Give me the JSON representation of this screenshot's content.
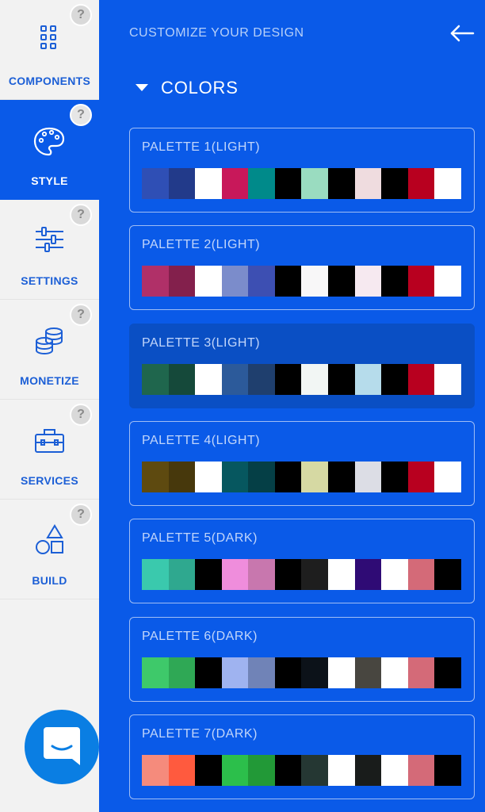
{
  "sidebar": {
    "items": [
      {
        "label": "COMPONENTS",
        "icon": "grid-icon",
        "active": false
      },
      {
        "label": "STYLE",
        "icon": "palette-icon",
        "active": true
      },
      {
        "label": "SETTINGS",
        "icon": "sliders-icon",
        "active": false
      },
      {
        "label": "MONETIZE",
        "icon": "coins-icon",
        "active": false
      },
      {
        "label": "SERVICES",
        "icon": "toolbox-icon",
        "active": false
      },
      {
        "label": "BUILD",
        "icon": "shapes-icon",
        "active": false
      }
    ],
    "help_label": "?"
  },
  "header": {
    "title": "CUSTOMIZE YOUR DESIGN",
    "back_icon": "arrow-left-icon"
  },
  "section": {
    "title": "COLORS",
    "expanded": true
  },
  "palettes": [
    {
      "name": "PALETTE 1(LIGHT)",
      "colors": [
        "#2f4fb5",
        "#223a8a",
        "#ffffff",
        "#c8185a",
        "#008a8a",
        "#000000",
        "#9adcc0",
        "#000000",
        "#efdcdf",
        "#000000",
        "#b8001f",
        "#ffffff"
      ]
    },
    {
      "name": "PALETTE 2(LIGHT)",
      "colors": [
        "#b03068",
        "#83204c",
        "#ffffff",
        "#7b8ccb",
        "#3d4fb2",
        "#000000",
        "#f8f7f8",
        "#000000",
        "#f6e9f0",
        "#000000",
        "#b8001f",
        "#ffffff"
      ]
    },
    {
      "name": "PALETTE 3(LIGHT)",
      "selected": true,
      "colors": [
        "#1f664d",
        "#15493a",
        "#ffffff",
        "#2c5a9a",
        "#1f3f6e",
        "#000000",
        "#f2f6f4",
        "#000000",
        "#b6dceb",
        "#000000",
        "#b8001f",
        "#ffffff"
      ]
    },
    {
      "name": "PALETTE 4(LIGHT)",
      "colors": [
        "#5e4a10",
        "#47380c",
        "#ffffff",
        "#06575f",
        "#053f46",
        "#000000",
        "#d6d9a3",
        "#000000",
        "#dcdde5",
        "#000000",
        "#b8001f",
        "#ffffff"
      ]
    },
    {
      "name": "PALETTE 5(DARK)",
      "colors": [
        "#3ac9ad",
        "#2fa88f",
        "#000000",
        "#ef8ddc",
        "#c877ae",
        "#000000",
        "#1e1e1e",
        "#ffffff",
        "#2f0b75",
        "#ffffff",
        "#d46a78",
        "#000000"
      ]
    },
    {
      "name": "PALETTE 6(DARK)",
      "colors": [
        "#3ec96a",
        "#2fa855",
        "#000000",
        "#9fb3f0",
        "#7083b7",
        "#000000",
        "#0c1219",
        "#ffffff",
        "#484640",
        "#ffffff",
        "#d46a78",
        "#000000"
      ]
    },
    {
      "name": "PALETTE 7(DARK)",
      "colors": [
        "#f58b7c",
        "#ff5a3e",
        "#000000",
        "#2cbf4b",
        "#229937",
        "#000000",
        "#253733",
        "#ffffff",
        "#191c1b",
        "#ffffff",
        "#d46a78",
        "#000000"
      ]
    }
  ],
  "chat_icon": "chat-bubble-icon"
}
